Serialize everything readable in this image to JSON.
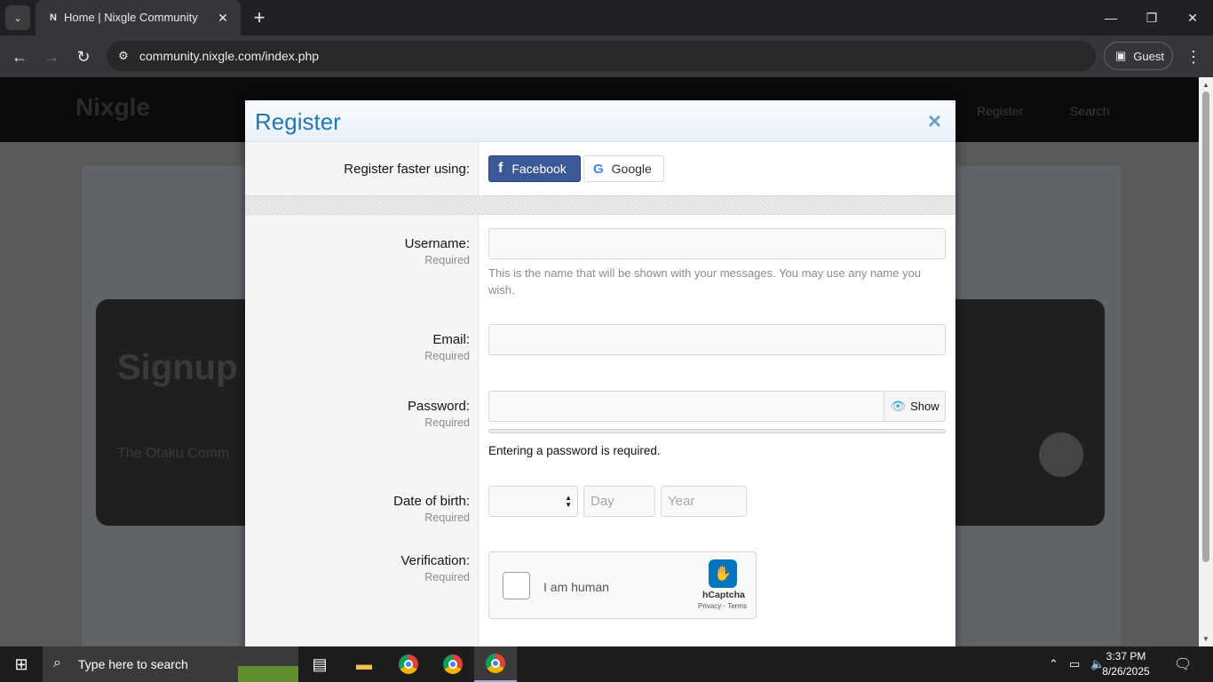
{
  "browser": {
    "tab_title": "Home | Nixgle Community",
    "tab_favicon": "N",
    "url": "community.nixgle.com/index.php",
    "profile_label": "Guest"
  },
  "site": {
    "logo": "Nixgle",
    "nav_right": [
      "Register",
      "Search"
    ],
    "hero_title": "Signup T",
    "hero_subtitle": "The Otaku Comm"
  },
  "modal": {
    "title": "Register",
    "close_glyph": "×",
    "social_label": "Register faster using:",
    "facebook_label": "Facebook",
    "google_label": "Google",
    "required": "Required",
    "username": {
      "label": "Username:",
      "hint": "This is the name that will be shown with your messages. You may use any name you wish."
    },
    "email": {
      "label": "Email:"
    },
    "password": {
      "label": "Password:",
      "show_label": "Show",
      "message": "Entering a password is required."
    },
    "dob": {
      "label": "Date of birth:",
      "day_placeholder": "Day",
      "year_placeholder": "Year"
    },
    "verification": {
      "label": "Verification:",
      "checkbox_text": "I am human",
      "brand": "hCaptcha",
      "links": "Privacy - Terms"
    }
  },
  "taskbar": {
    "search_placeholder": "Type here to search",
    "time": "3:37 PM",
    "date": "8/26/2025"
  },
  "colors": {
    "accent": "#2577b1",
    "facebook": "#3b5998",
    "modal_header": "#e9f2fa"
  }
}
